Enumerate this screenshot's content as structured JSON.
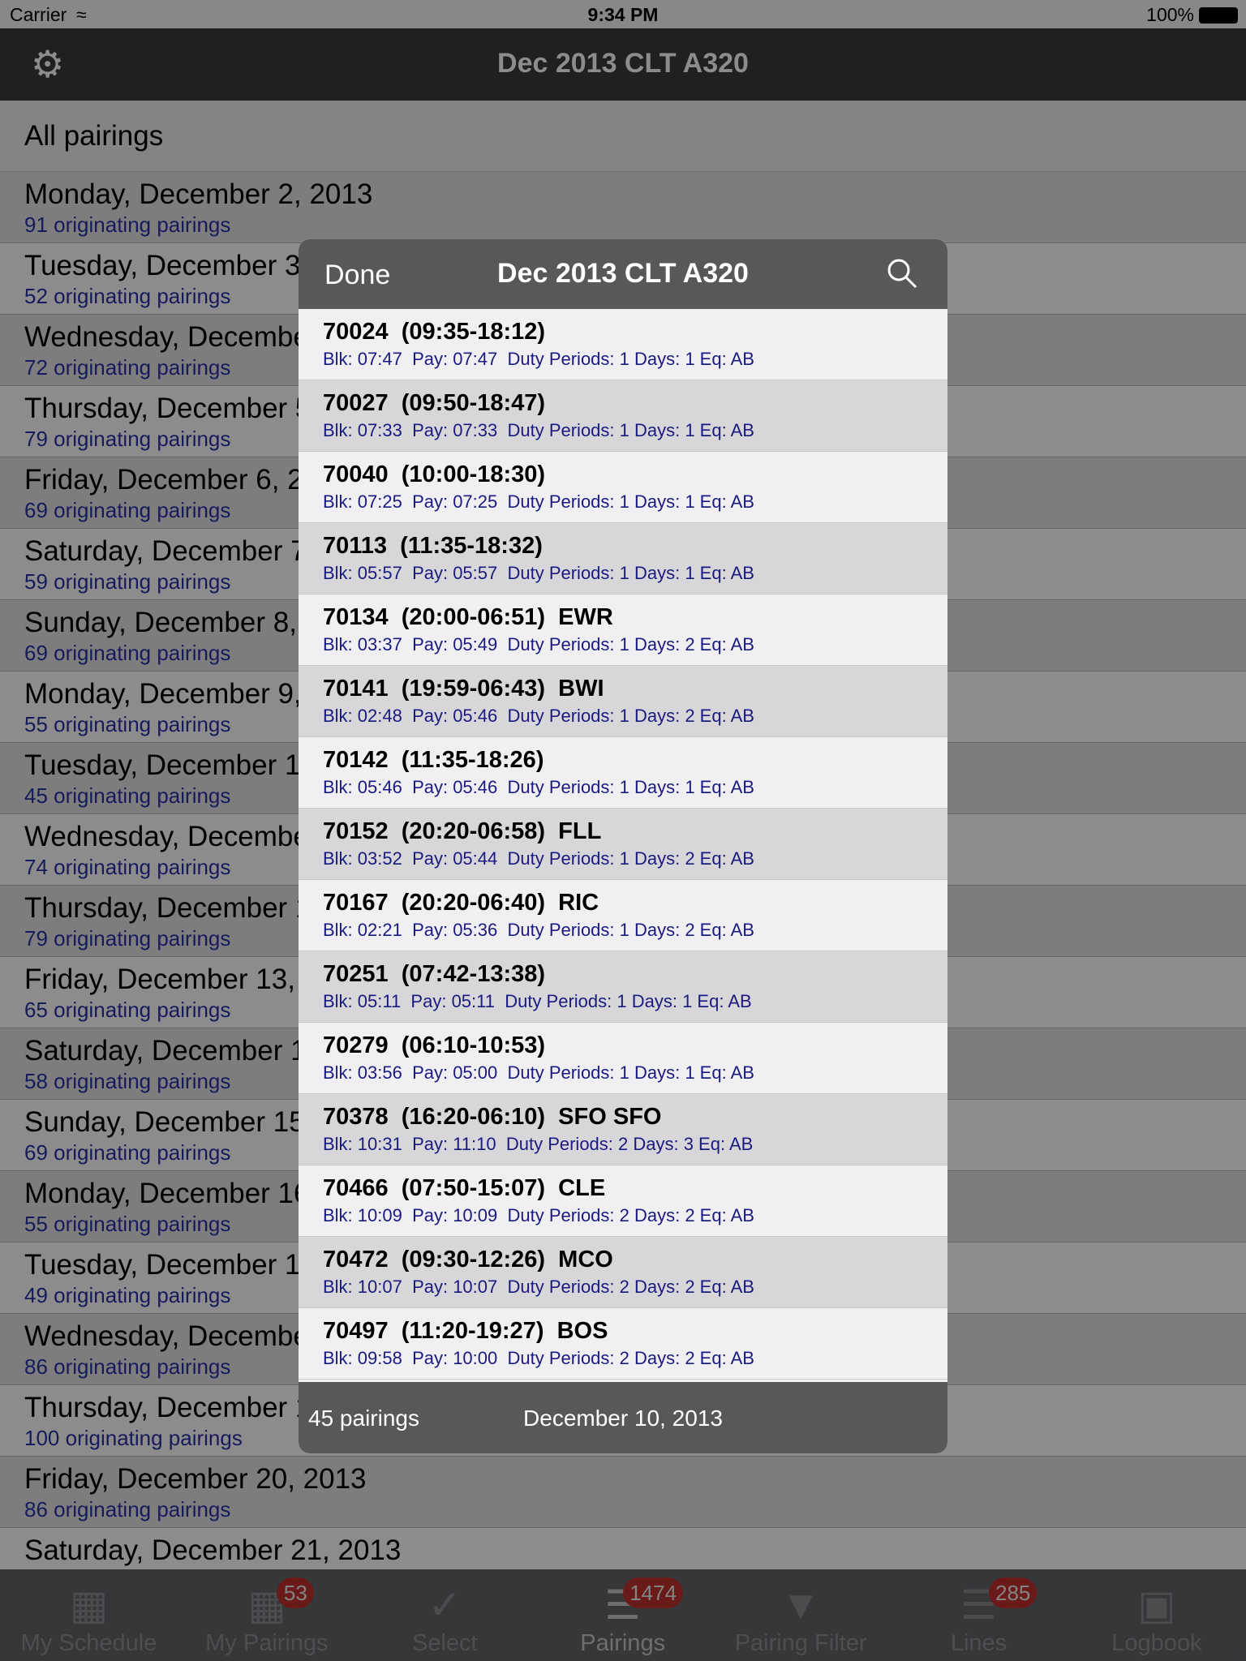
{
  "status": {
    "carrier": "Carrier",
    "time": "9:34 PM",
    "battery": "100%"
  },
  "nav": {
    "title": "Dec 2013 CLT A320",
    "settings_icon": "gear-icon"
  },
  "list": {
    "header": "All pairings",
    "days": [
      {
        "date": "Monday, December 2, 2013",
        "count": "91 originating pairings"
      },
      {
        "date": "Tuesday, December 3, 2013",
        "count": "52 originating pairings"
      },
      {
        "date": "Wednesday, December 4, 2013",
        "count": "72 originating pairings"
      },
      {
        "date": "Thursday, December 5, 2013",
        "count": "79 originating pairings"
      },
      {
        "date": "Friday, December 6, 2013",
        "count": "69 originating pairings"
      },
      {
        "date": "Saturday, December 7, 2013",
        "count": "59 originating pairings"
      },
      {
        "date": "Sunday, December 8, 2013",
        "count": "69 originating pairings"
      },
      {
        "date": "Monday, December 9, 2013",
        "count": "55 originating pairings"
      },
      {
        "date": "Tuesday, December 10, 2013",
        "count": "45 originating pairings"
      },
      {
        "date": "Wednesday, December 11, 2013",
        "count": "74 originating pairings"
      },
      {
        "date": "Thursday, December 12, 2013",
        "count": "79 originating pairings"
      },
      {
        "date": "Friday, December 13, 2013",
        "count": "65 originating pairings"
      },
      {
        "date": "Saturday, December 14, 2013",
        "count": "58 originating pairings"
      },
      {
        "date": "Sunday, December 15, 2013",
        "count": "69 originating pairings"
      },
      {
        "date": "Monday, December 16, 2013",
        "count": "55 originating pairings"
      },
      {
        "date": "Tuesday, December 17, 2013",
        "count": "49 originating pairings"
      },
      {
        "date": "Wednesday, December 18, 2013",
        "count": "86 originating pairings"
      },
      {
        "date": "Thursday, December 19, 2013",
        "count": "100 originating pairings"
      },
      {
        "date": "Friday, December 20, 2013",
        "count": "86 originating pairings"
      },
      {
        "date": "Saturday, December 21, 2013",
        "count": ""
      }
    ]
  },
  "popup": {
    "done": "Done",
    "title": "Dec 2013 CLT A320",
    "search_icon": "search-icon",
    "pairings": [
      {
        "title": "70024  (09:35-18:12)",
        "detail": "Blk: 07:47  Pay: 07:47  Duty Periods: 1 Days: 1 Eq: AB"
      },
      {
        "title": "70027  (09:50-18:47)",
        "detail": "Blk: 07:33  Pay: 07:33  Duty Periods: 1 Days: 1 Eq: AB"
      },
      {
        "title": "70040  (10:00-18:30)",
        "detail": "Blk: 07:25  Pay: 07:25  Duty Periods: 1 Days: 1 Eq: AB"
      },
      {
        "title": "70113  (11:35-18:32)",
        "detail": "Blk: 05:57  Pay: 05:57  Duty Periods: 1 Days: 1 Eq: AB"
      },
      {
        "title": "70134  (20:00-06:51)  EWR",
        "detail": "Blk: 03:37  Pay: 05:49  Duty Periods: 1 Days: 2 Eq: AB"
      },
      {
        "title": "70141  (19:59-06:43)  BWI",
        "detail": "Blk: 02:48  Pay: 05:46  Duty Periods: 1 Days: 2 Eq: AB"
      },
      {
        "title": "70142  (11:35-18:26)",
        "detail": "Blk: 05:46  Pay: 05:46  Duty Periods: 1 Days: 1 Eq: AB"
      },
      {
        "title": "70152  (20:20-06:58)  FLL",
        "detail": "Blk: 03:52  Pay: 05:44  Duty Periods: 1 Days: 2 Eq: AB"
      },
      {
        "title": "70167  (20:20-06:40)  RIC",
        "detail": "Blk: 02:21  Pay: 05:36  Duty Periods: 1 Days: 2 Eq: AB"
      },
      {
        "title": "70251  (07:42-13:38)",
        "detail": "Blk: 05:11  Pay: 05:11  Duty Periods: 1 Days: 1 Eq: AB"
      },
      {
        "title": "70279  (06:10-10:53)",
        "detail": "Blk: 03:56  Pay: 05:00  Duty Periods: 1 Days: 1 Eq: AB"
      },
      {
        "title": "70378  (16:20-06:10)  SFO SFO",
        "detail": "Blk: 10:31  Pay: 11:10  Duty Periods: 2 Days: 3 Eq: AB"
      },
      {
        "title": "70466  (07:50-15:07)  CLE",
        "detail": "Blk: 10:09  Pay: 10:09  Duty Periods: 2 Days: 2 Eq: AB"
      },
      {
        "title": "70472  (09:30-12:26)  MCO",
        "detail": "Blk: 10:07  Pay: 10:07  Duty Periods: 2 Days: 2 Eq: AB"
      },
      {
        "title": "70497  (11:20-19:27)  BOS",
        "detail": "Blk: 09:58  Pay: 10:00  Duty Periods: 2 Days: 2 Eq: AB"
      }
    ],
    "footer_count": "45 pairings",
    "footer_date": "December 10, 2013"
  },
  "tabs": [
    {
      "label": "My Schedule",
      "icon": "calendar-icon",
      "badge": ""
    },
    {
      "label": "My Pairings",
      "icon": "calendar-icon",
      "badge": "53"
    },
    {
      "label": "Select",
      "icon": "checkmark-icon",
      "badge": ""
    },
    {
      "label": "Pairings",
      "icon": "list-icon",
      "badge": "1474",
      "active": true
    },
    {
      "label": "Pairing Filter",
      "icon": "funnel-icon",
      "badge": ""
    },
    {
      "label": "Lines",
      "icon": "list-icon",
      "badge": "285"
    },
    {
      "label": "Logbook",
      "icon": "logbook-icon",
      "badge": ""
    }
  ],
  "colors": {
    "badge": "#c0302e",
    "nav": "#3a3b3f",
    "detail_text": "#1a1a80"
  }
}
